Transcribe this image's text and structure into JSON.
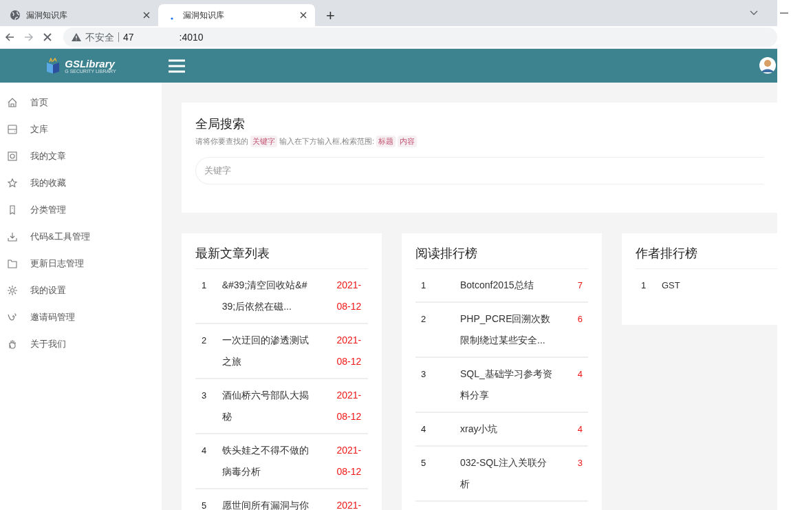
{
  "browser": {
    "tabs": [
      {
        "title": "漏洞知识库",
        "selected": false,
        "loading": false
      },
      {
        "title": "漏洞知识库",
        "selected": true,
        "loading": true
      }
    ],
    "new_tab": "+",
    "address": {
      "warning": "不安全",
      "host_start": "47",
      "host_end": ":4010"
    }
  },
  "header": {
    "logo": "GSLibrary",
    "logo_sub": "G SECURITY LIBRARY"
  },
  "sidebar": {
    "items": [
      {
        "label": "首页"
      },
      {
        "label": "文库"
      },
      {
        "label": "我的文章"
      },
      {
        "label": "我的收藏"
      },
      {
        "label": "分类管理"
      },
      {
        "label": "代码&工具管理"
      },
      {
        "label": "更新日志管理"
      },
      {
        "label": "我的设置"
      },
      {
        "label": "邀请码管理"
      },
      {
        "label": "关于我们"
      }
    ]
  },
  "search": {
    "title": "全局搜索",
    "hint": [
      {
        "kind": "text",
        "text": "请将你要查找的"
      },
      {
        "kind": "tag",
        "text": "关键字"
      },
      {
        "kind": "text",
        "text": "输入在下方输入框,检索范围:"
      },
      {
        "kind": "tag",
        "text": "标题"
      },
      {
        "kind": "tag",
        "text": "内容"
      }
    ],
    "placeholder": "关键字"
  },
  "latest": {
    "title": "最新文章列表",
    "rows": [
      {
        "rank": "1",
        "title": "&#39;清空回收站&#39;后依然在磁...",
        "date": "2021-08-12"
      },
      {
        "rank": "2",
        "title": "一次迂回的渗透测试之旅",
        "date": "2021-08-12"
      },
      {
        "rank": "3",
        "title": "酒仙桥六号部队大揭秘",
        "date": "2021-08-12"
      },
      {
        "rank": "4",
        "title": "铁头娃之不得不做的病毒分析",
        "date": "2021-08-12"
      },
      {
        "rank": "5",
        "title": "愿世间所有漏洞与你",
        "date": "2021-"
      }
    ]
  },
  "reading": {
    "title": "阅读排行榜",
    "rows": [
      {
        "rank": "1",
        "title": "Botconf2015总结",
        "count": "7"
      },
      {
        "rank": "2",
        "title": "PHP_PCRE回溯次数限制绕过某些安全...",
        "count": "6"
      },
      {
        "rank": "3",
        "title": "SQL_基础学习参考资料分享",
        "count": "4"
      },
      {
        "rank": "4",
        "title": "xray小坑",
        "count": "4"
      },
      {
        "rank": "5",
        "title": "032-SQL注入关联分析",
        "count": "3"
      }
    ]
  },
  "authors": {
    "title": "作者排行榜",
    "rows": [
      {
        "rank": "1",
        "name": "GST"
      }
    ]
  }
}
